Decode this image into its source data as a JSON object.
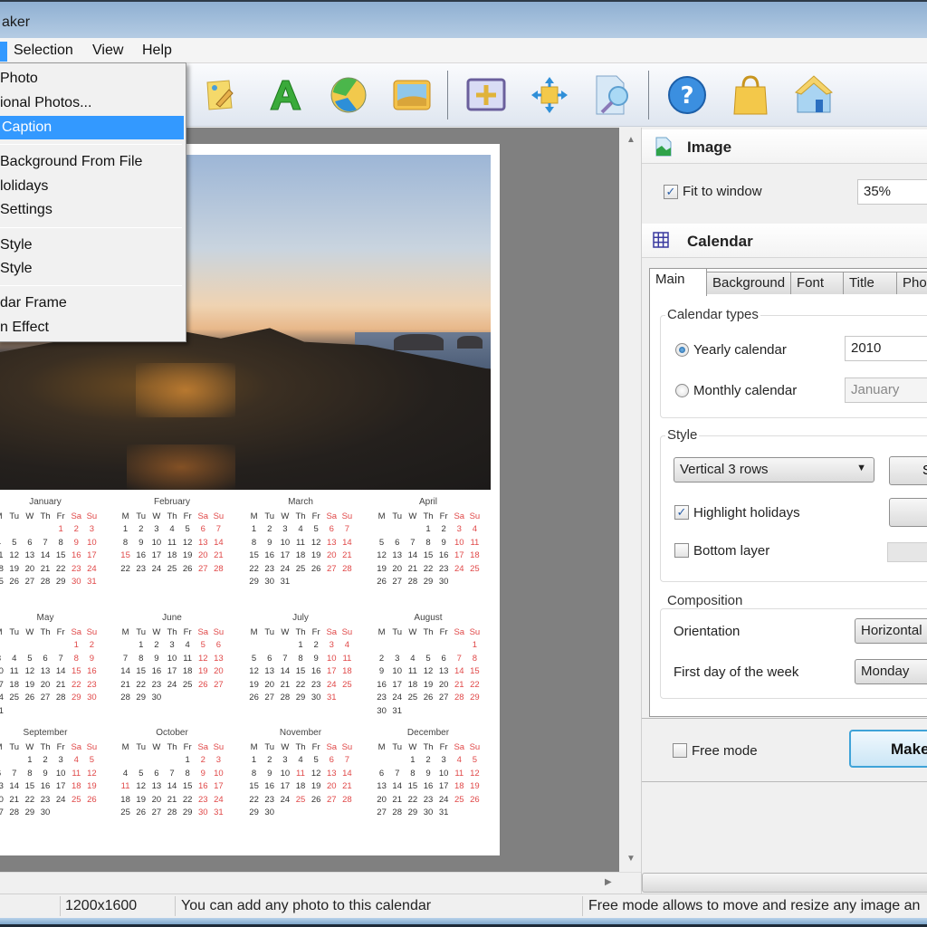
{
  "window": {
    "title": "aker"
  },
  "menubar": {
    "items": [
      {
        "label": ""
      },
      {
        "label": "Selection"
      },
      {
        "label": "View"
      },
      {
        "label": "Help"
      }
    ]
  },
  "dropdown_menu": {
    "items": [
      {
        "label": "Photo"
      },
      {
        "label": "ional Photos..."
      },
      {
        "label": "Caption",
        "highlighted": true
      },
      {
        "label": "Background From File"
      },
      {
        "label": "lolidays"
      },
      {
        "label": "Settings"
      },
      {
        "label": "Style"
      },
      {
        "label": "Style"
      },
      {
        "label": "dar Frame"
      },
      {
        "label": "n Effect"
      }
    ]
  },
  "toolbar": {
    "buttons": [
      {
        "icon": "edit-note-icon"
      },
      {
        "icon": "text-icon"
      },
      {
        "icon": "ball-icon"
      },
      {
        "icon": "picture-icon"
      },
      {
        "icon": "fit-frame-icon"
      },
      {
        "icon": "move-arrows-icon"
      },
      {
        "icon": "zoom-page-icon"
      },
      {
        "icon": "help-icon"
      },
      {
        "icon": "shopping-bag-icon"
      },
      {
        "icon": "home-icon"
      }
    ]
  },
  "calendar_preview": {
    "year": 2010,
    "weekday_headers": [
      "M",
      "Tu",
      "W",
      "Th",
      "Fr",
      "Sa",
      "Su"
    ],
    "holiday_color": "#e04848",
    "months": [
      {
        "name": "January",
        "start": 4,
        "days": 31,
        "holidays": [
          1
        ]
      },
      {
        "name": "February",
        "start": 0,
        "days": 28,
        "holidays": [
          15
        ]
      },
      {
        "name": "March",
        "start": 0,
        "days": 31,
        "holidays": []
      },
      {
        "name": "April",
        "start": 3,
        "days": 30,
        "holidays": []
      },
      {
        "name": "May",
        "start": 5,
        "days": 31,
        "holidays": []
      },
      {
        "name": "June",
        "start": 1,
        "days": 30,
        "holidays": []
      },
      {
        "name": "July",
        "start": 3,
        "days": 31,
        "holidays": []
      },
      {
        "name": "August",
        "start": 6,
        "days": 31,
        "holidays": []
      },
      {
        "name": "September",
        "start": 2,
        "days": 30,
        "holidays": []
      },
      {
        "name": "October",
        "start": 4,
        "days": 31,
        "holidays": [
          11
        ]
      },
      {
        "name": "November",
        "start": 0,
        "days": 30,
        "holidays": [
          11,
          25
        ]
      },
      {
        "name": "December",
        "start": 2,
        "days": 31,
        "holidays": []
      }
    ]
  },
  "panel": {
    "image_section": {
      "title": "Image",
      "fit_to_window_label": "Fit to window",
      "fit_to_window_checked": true,
      "zoom_value": "35%"
    },
    "calendar_section": {
      "title": "Calendar",
      "tabs": [
        {
          "label": "Main",
          "active": true
        },
        {
          "label": "Background"
        },
        {
          "label": "Font"
        },
        {
          "label": "Title"
        },
        {
          "label": "Pho"
        }
      ],
      "calendar_types": {
        "title": "Calendar types",
        "yearly_label": "Yearly calendar",
        "yearly_selected": true,
        "year_value": "2010",
        "monthly_label": "Monthly calendar",
        "month_value": "January"
      },
      "style": {
        "title": "Style",
        "style_value": "Vertical 3 rows",
        "side_button_label": "S",
        "highlight_holidays_label": "Highlight holidays",
        "highlight_holidays_checked": true,
        "bottom_layer_label": "Bottom layer",
        "bottom_layer_checked": false
      },
      "composition": {
        "title": "Composition",
        "orientation_label": "Orientation",
        "orientation_value": "Horizontal",
        "first_day_label": "First day of the week",
        "first_day_value": "Monday"
      }
    },
    "free_mode_label": "Free mode",
    "free_mode_checked": false,
    "make_button_label": "Make"
  },
  "statusbar": {
    "size": "1200x1600",
    "hint": "You can add any photo to this calendar",
    "free_mode_hint": "Free mode allows to move and resize any image an"
  }
}
